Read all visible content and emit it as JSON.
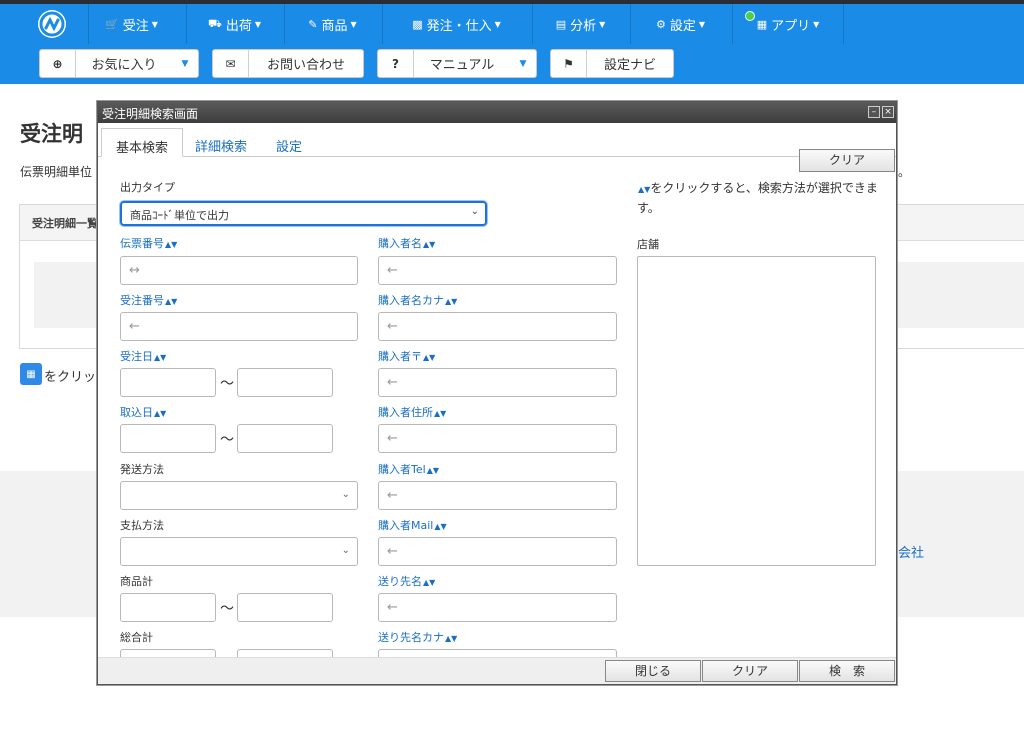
{
  "nav": {
    "items": [
      {
        "label": "受注",
        "icon": "cart-icon"
      },
      {
        "label": "出荷",
        "icon": "truck-icon"
      },
      {
        "label": "商品",
        "icon": "pencil-icon"
      },
      {
        "label": "発注・仕入",
        "icon": "inbox-icon"
      },
      {
        "label": "分析",
        "icon": "chart-icon"
      },
      {
        "label": "設定",
        "icon": "gear-icon"
      },
      {
        "label": "アプリ",
        "icon": "grid-icon"
      }
    ],
    "brand_color": "#1a8be6"
  },
  "toolbar": {
    "favorites": "お気に入り",
    "contact": "お問い合わせ",
    "manual": "マニュアル",
    "setup_navi": "設定ナビ"
  },
  "page": {
    "title_partial": "受注明",
    "desc_partial": "伝票明細単位",
    "desc_tail": "。",
    "panel_head": "受注明細一覧",
    "cal_text": "をクリッ",
    "footer_company": "会社"
  },
  "dialog": {
    "title": "受注明細検索画面",
    "tabs": [
      "基本検索",
      "詳細検索",
      "設定"
    ],
    "clear_top": "クリア",
    "output_type_label": "出力タイプ",
    "output_type_value": "商品ｺｰﾄﾞ単位で出力",
    "hint": "をクリックすると、検索方法が選択できます。",
    "store_label": "店舗",
    "left_fields": {
      "slip_no": "伝票番号",
      "order_no": "受注番号",
      "order_date": "受注日",
      "import_date": "取込日",
      "ship_method": "発送方法",
      "pay_method": "支払方法",
      "goods_total": "商品計",
      "grand_total": "総合計"
    },
    "right_fields": {
      "buyer_name": "購入者名",
      "buyer_kana": "購入者名カナ",
      "buyer_zip": "購入者〒",
      "buyer_addr": "購入者住所",
      "buyer_tel": "購入者Tel",
      "buyer_mail": "購入者Mail",
      "dest_name": "送り先名",
      "dest_kana": "送り先名カナ"
    },
    "tilde": "〜",
    "footer": {
      "close": "閉じる",
      "clear": "クリア",
      "search": "検　索"
    }
  }
}
